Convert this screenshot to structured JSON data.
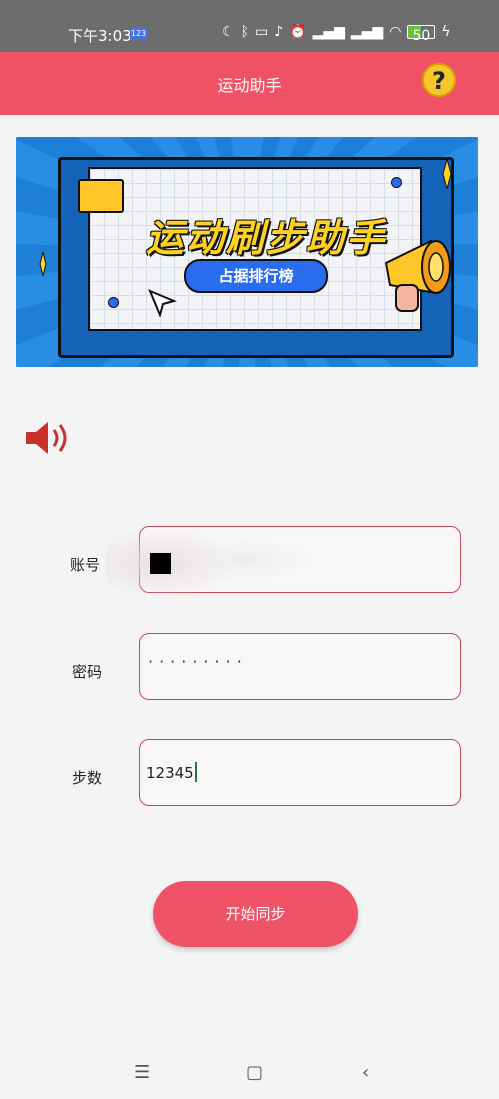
{
  "status_bar": {
    "time": "下午3:03",
    "badge": "123",
    "battery": "50",
    "battery_level": 0.5,
    "icons": [
      "moon-icon",
      "bluetooth-icon",
      "vibrate-icon",
      "mute-icon",
      "alarm-icon",
      "signal-hd-icon",
      "signal-hd-icon",
      "wifi-icon",
      "battery-icon",
      "charging-icon"
    ]
  },
  "app_bar": {
    "title": "运动助手",
    "help_label": "?"
  },
  "banner": {
    "headline": "运动刷步助手",
    "pill": "占据排行榜"
  },
  "form": {
    "account_label": "账号",
    "password_label": "密码",
    "password_mask": "·········",
    "steps_label": "步数",
    "steps_value": "12345"
  },
  "start_button": "开始同步",
  "colors": {
    "primary": "#ef5266",
    "field_border": "#c2485a",
    "help_yellow": "#f7c62b",
    "banner_blue": "#1e7fd6",
    "speaker_red": "#c9302c"
  },
  "nav": [
    "menu-icon",
    "home-icon",
    "back-icon"
  ]
}
